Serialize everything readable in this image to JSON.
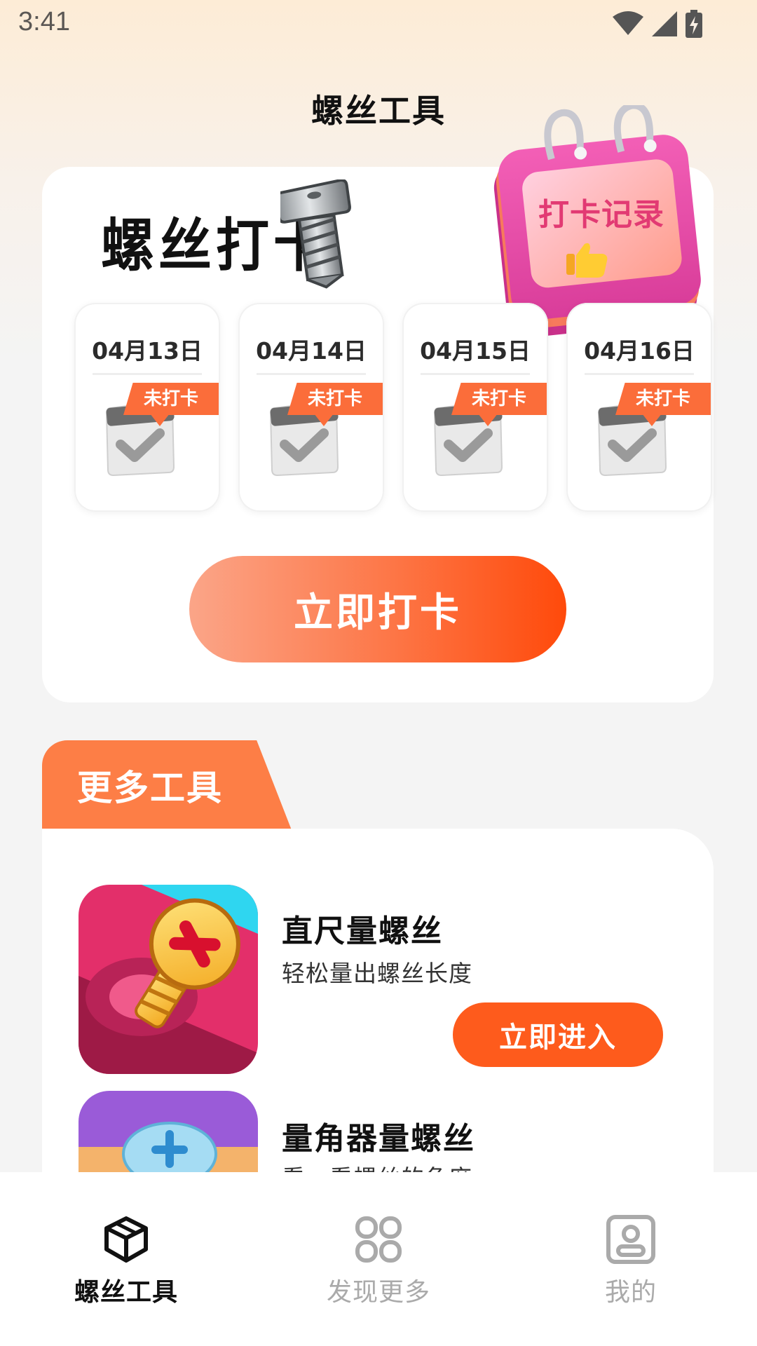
{
  "status_bar": {
    "time": "3:41",
    "icons": [
      "wifi-icon",
      "signal-icon",
      "battery-charging-icon"
    ]
  },
  "app_title": "螺丝工具",
  "checkin": {
    "heading": "螺丝打卡",
    "record_label": "打卡记录",
    "days": [
      {
        "date": "04月13日",
        "status": "未打卡"
      },
      {
        "date": "04月14日",
        "status": "未打卡"
      },
      {
        "date": "04月15日",
        "status": "未打卡"
      },
      {
        "date": "04月16日",
        "status": "未打卡"
      }
    ],
    "button_label": "立即打卡"
  },
  "more_tools": {
    "section_title": "更多工具",
    "items": [
      {
        "name": "直尺量螺丝",
        "desc": "轻松量出螺丝长度",
        "button_label": "立即进入"
      },
      {
        "name": "量角器量螺丝",
        "desc": "看一看螺丝的角度"
      }
    ]
  },
  "bottom_nav": {
    "items": [
      {
        "label": "螺丝工具",
        "icon": "box-icon",
        "active": true
      },
      {
        "label": "发现更多",
        "icon": "grid-icon",
        "active": false
      },
      {
        "label": "我的",
        "icon": "profile-icon",
        "active": false
      }
    ]
  },
  "colors": {
    "accent": "#fe5b1c",
    "tab_orange": "#fd7e46",
    "record_pink": "#e23a73",
    "nav_active": "#111111",
    "nav_inactive": "#aaaaaa"
  }
}
